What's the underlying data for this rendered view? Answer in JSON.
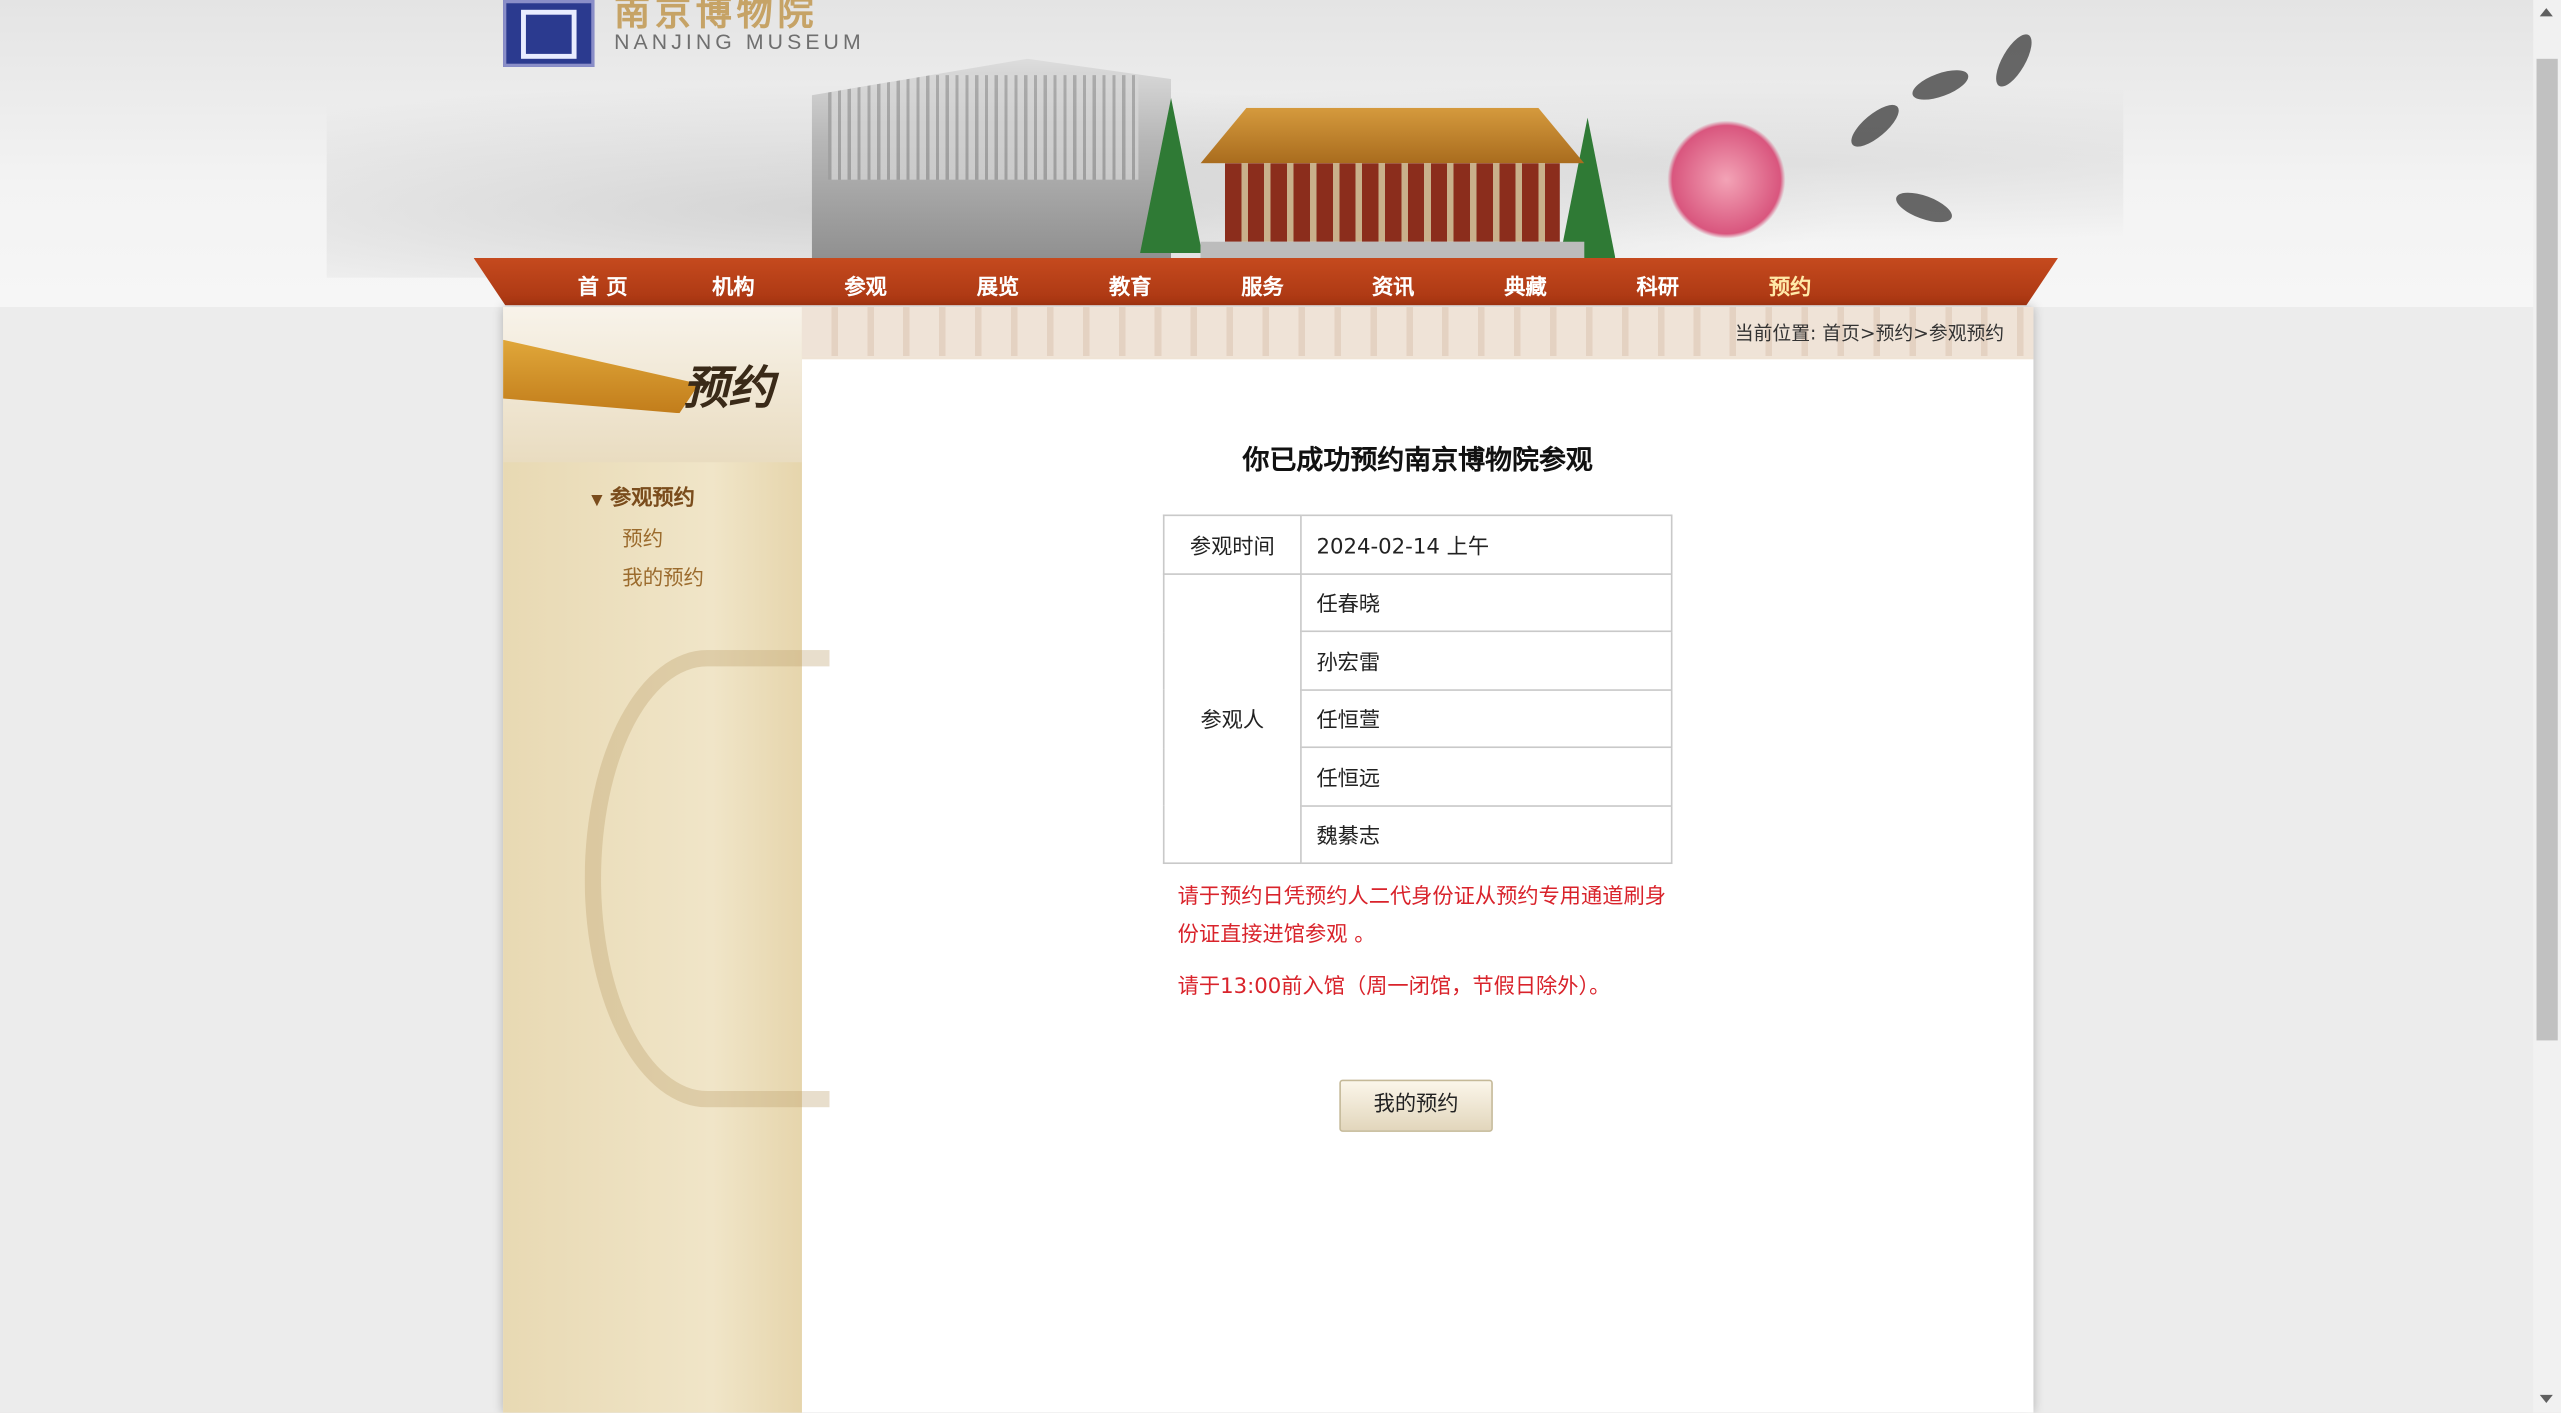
{
  "header": {
    "logo_cn": "南京博物院",
    "logo_en": "NANJING MUSEUM"
  },
  "nav": {
    "items": [
      "首 页",
      "机构",
      "参观",
      "展览",
      "教育",
      "服务",
      "资讯",
      "典藏",
      "科研",
      "预约"
    ],
    "active": "预约"
  },
  "sidebar": {
    "title": "预约",
    "group": "参观预约",
    "links": [
      "预约",
      "我的预约"
    ]
  },
  "breadcrumb": {
    "prefix": "当前位置:",
    "items": [
      "首页",
      "预约",
      "参观预约"
    ],
    "separator": ">"
  },
  "main": {
    "title": "你已成功预约南京博物院参观",
    "visit_time_label": "参观时间",
    "visit_time": "2024-02-14 上午",
    "visitors_label": "参观人",
    "visitors": [
      "任春晓",
      "孙宏雷",
      "任恒萱",
      "任恒远",
      "魏綦志"
    ],
    "notice_1": "请于预约日凭预约人二代身份证从预约专用通道刷身份证直接进馆参观 。",
    "notice_2": "请于13:00前入馆（周一闭馆，节假日除外）。",
    "button_label": "我的预约"
  },
  "colors": {
    "nav_red": "#b13d16",
    "notice_red": "#d9232b",
    "menu_brown": "#7a4c1c"
  }
}
